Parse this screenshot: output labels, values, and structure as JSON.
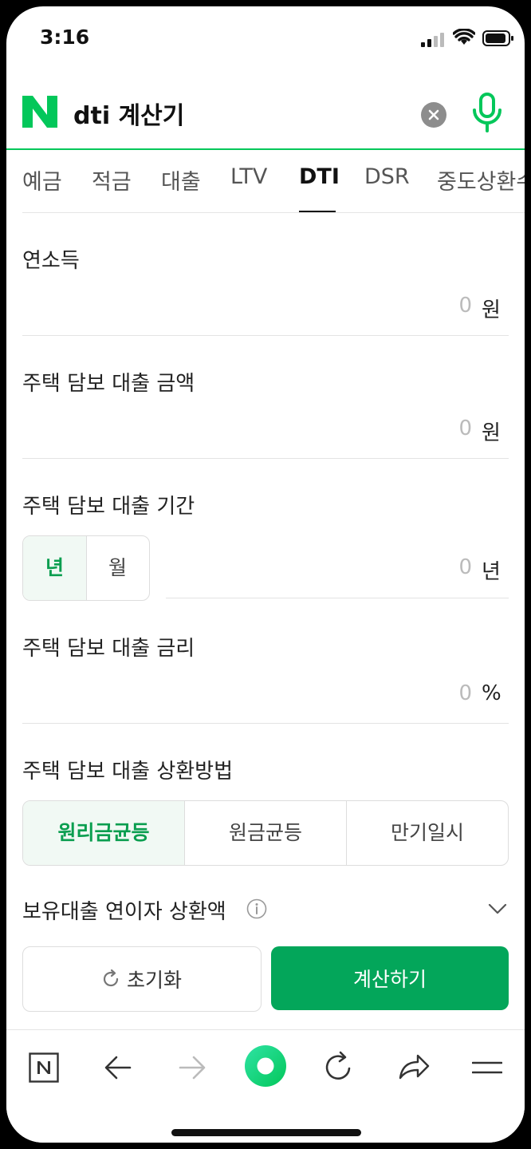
{
  "status_bar": {
    "time": "3:16"
  },
  "search": {
    "query": "dti 계산기"
  },
  "tabs": [
    "예금",
    "적금",
    "대출",
    "LTV",
    "DTI",
    "DSR",
    "중도상환수"
  ],
  "active_tab": "DTI",
  "form": {
    "annual_income": {
      "label": "연소득",
      "value": "0",
      "unit": "원"
    },
    "loan_amount": {
      "label": "주택 담보 대출 금액",
      "value": "0",
      "unit": "원"
    },
    "loan_period": {
      "label": "주택 담보 대출 기간",
      "options": [
        "년",
        "월"
      ],
      "selected": "년",
      "value": "0",
      "unit": "년"
    },
    "interest_rate": {
      "label": "주택 담보 대출 금리",
      "value": "0",
      "unit": "%"
    },
    "repayment_method": {
      "label": "주택 담보 대출 상환방법",
      "options": [
        "원리금균등",
        "원금균등",
        "만기일시"
      ],
      "selected": "원리금균등"
    },
    "existing_loan_interest": {
      "label": "보유대출 연이자 상환액"
    }
  },
  "buttons": {
    "reset": "초기화",
    "calculate": "계산하기"
  },
  "colors": {
    "brand_green": "#03c75a",
    "button_green": "#03a65a",
    "selected_text": "#0a9e4f"
  },
  "icons": [
    "naver-logo",
    "clear-icon",
    "mic-icon",
    "info-icon",
    "chevron-down-icon",
    "refresh-icon",
    "naver-home-icon",
    "back-arrow-icon",
    "forward-arrow-icon",
    "green-dot-icon",
    "reload-icon",
    "share-icon",
    "menu-icon"
  ]
}
